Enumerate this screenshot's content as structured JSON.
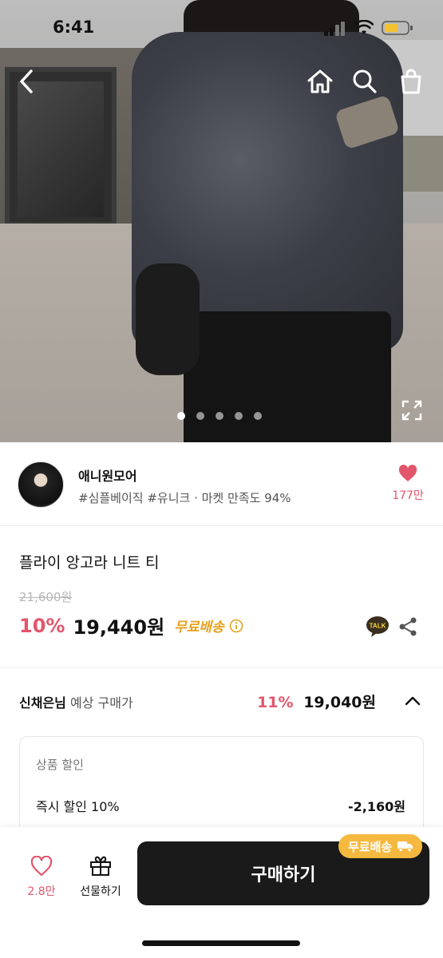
{
  "status_bar": {
    "time": "6:41"
  },
  "nav": {
    "back_icon": "chevron-left-icon",
    "home_icon": "home-icon",
    "search_icon": "search-icon",
    "bag_icon": "shopping-bag-icon"
  },
  "gallery": {
    "slide_count": 5,
    "active_index": 0,
    "expand_icon": "expand-icon"
  },
  "seller": {
    "name": "애니원모어",
    "tags": "#심플베이직 #유니크 · 마켓 만족도 94%",
    "like_count": "177만"
  },
  "product": {
    "name": "플라이 앙고라 니트 티",
    "original_price": "21,600원",
    "discount_rate": "10%",
    "final_price": "19,440원",
    "free_shipping": "무료배송"
  },
  "expected_price": {
    "user": "신채은님",
    "label": "예상 구매가",
    "rate": "11%",
    "price": "19,040원"
  },
  "discount_detail": {
    "title": "상품 할인",
    "item_label": "즉시 할인 10%",
    "item_amount": "-2,160원"
  },
  "bottom_bar": {
    "like_count": "2.8만",
    "gift_label": "선물하기",
    "buy_label": "구매하기",
    "shipping_badge": "무료배송"
  },
  "colors": {
    "accent_pink": "#e2566c",
    "shipping_gold": "#e6a21c",
    "badge_orange": "#f6b940",
    "buy_button": "#1a1a1a"
  }
}
